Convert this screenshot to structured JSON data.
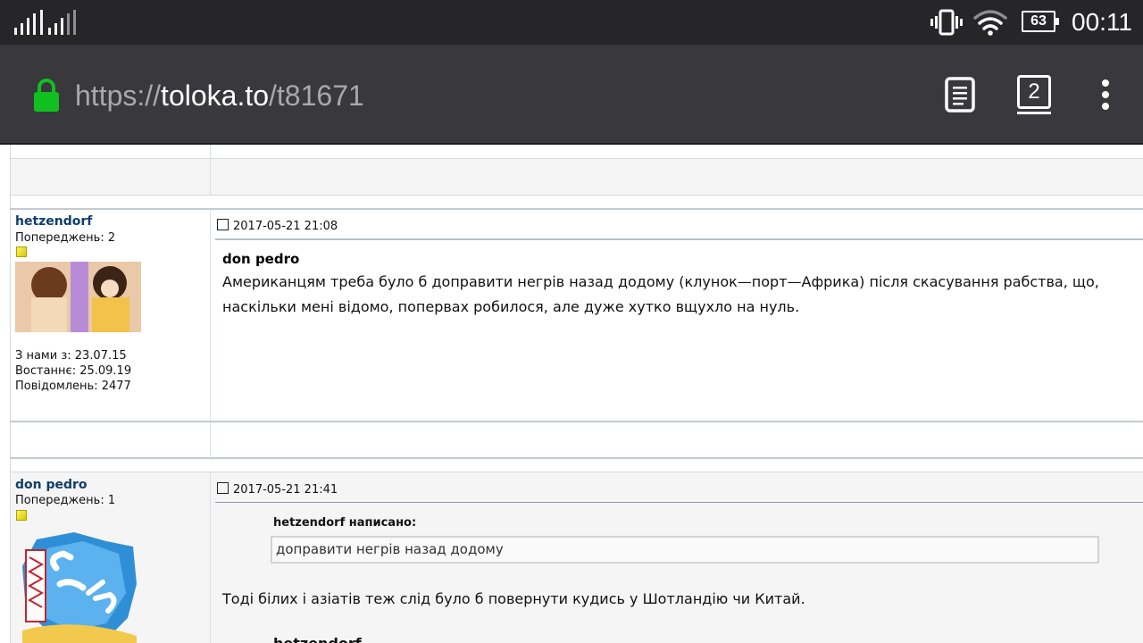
{
  "status": {
    "battery": "63",
    "time": "00:11"
  },
  "address_bar": {
    "scheme": "https://",
    "host": "toloka.to",
    "path": "/t81671",
    "tab_count": "2"
  },
  "posts": [
    {
      "username": "hetzendorf",
      "warnings": "Попереджень: 2",
      "joined": "З нами з: 23.07.15",
      "last_seen": "Востаннє: 25.09.19",
      "messages": "Повідомлень: 2477",
      "date": "2017-05-21 21:08",
      "quoted_author": "don pedro",
      "text": "Американцям треба було б доправити негрів назад додому (клунок—порт—Африка) після скасування рабства, що, наскільки мені відомо, попервах робилося, але дуже хутко вщухло на нуль."
    },
    {
      "username": "don pedro",
      "warnings": "Попереджень: 1",
      "date": "2017-05-21 21:41",
      "quote_header": "hetzendorf написано:",
      "quote_text": "доправити негрів назад додому",
      "text": "Тоді білих і азіатів теж слід було б повернути кудись у Шотландію чи Китай.",
      "cut_text": "hetzendorf"
    }
  ],
  "colors": {
    "status_bg": "#262628",
    "toolbar_bg": "#38383d",
    "lock_green": "#10c020",
    "username_blue": "#0f3e6a",
    "row_bg": "#f5f5f5"
  },
  "icons": [
    "signal-icon",
    "vibrate-icon",
    "wifi-icon",
    "battery-icon",
    "lock-icon",
    "reader-mode-icon",
    "tabs-icon",
    "menu-icon",
    "post-icon",
    "rank-icon"
  ]
}
